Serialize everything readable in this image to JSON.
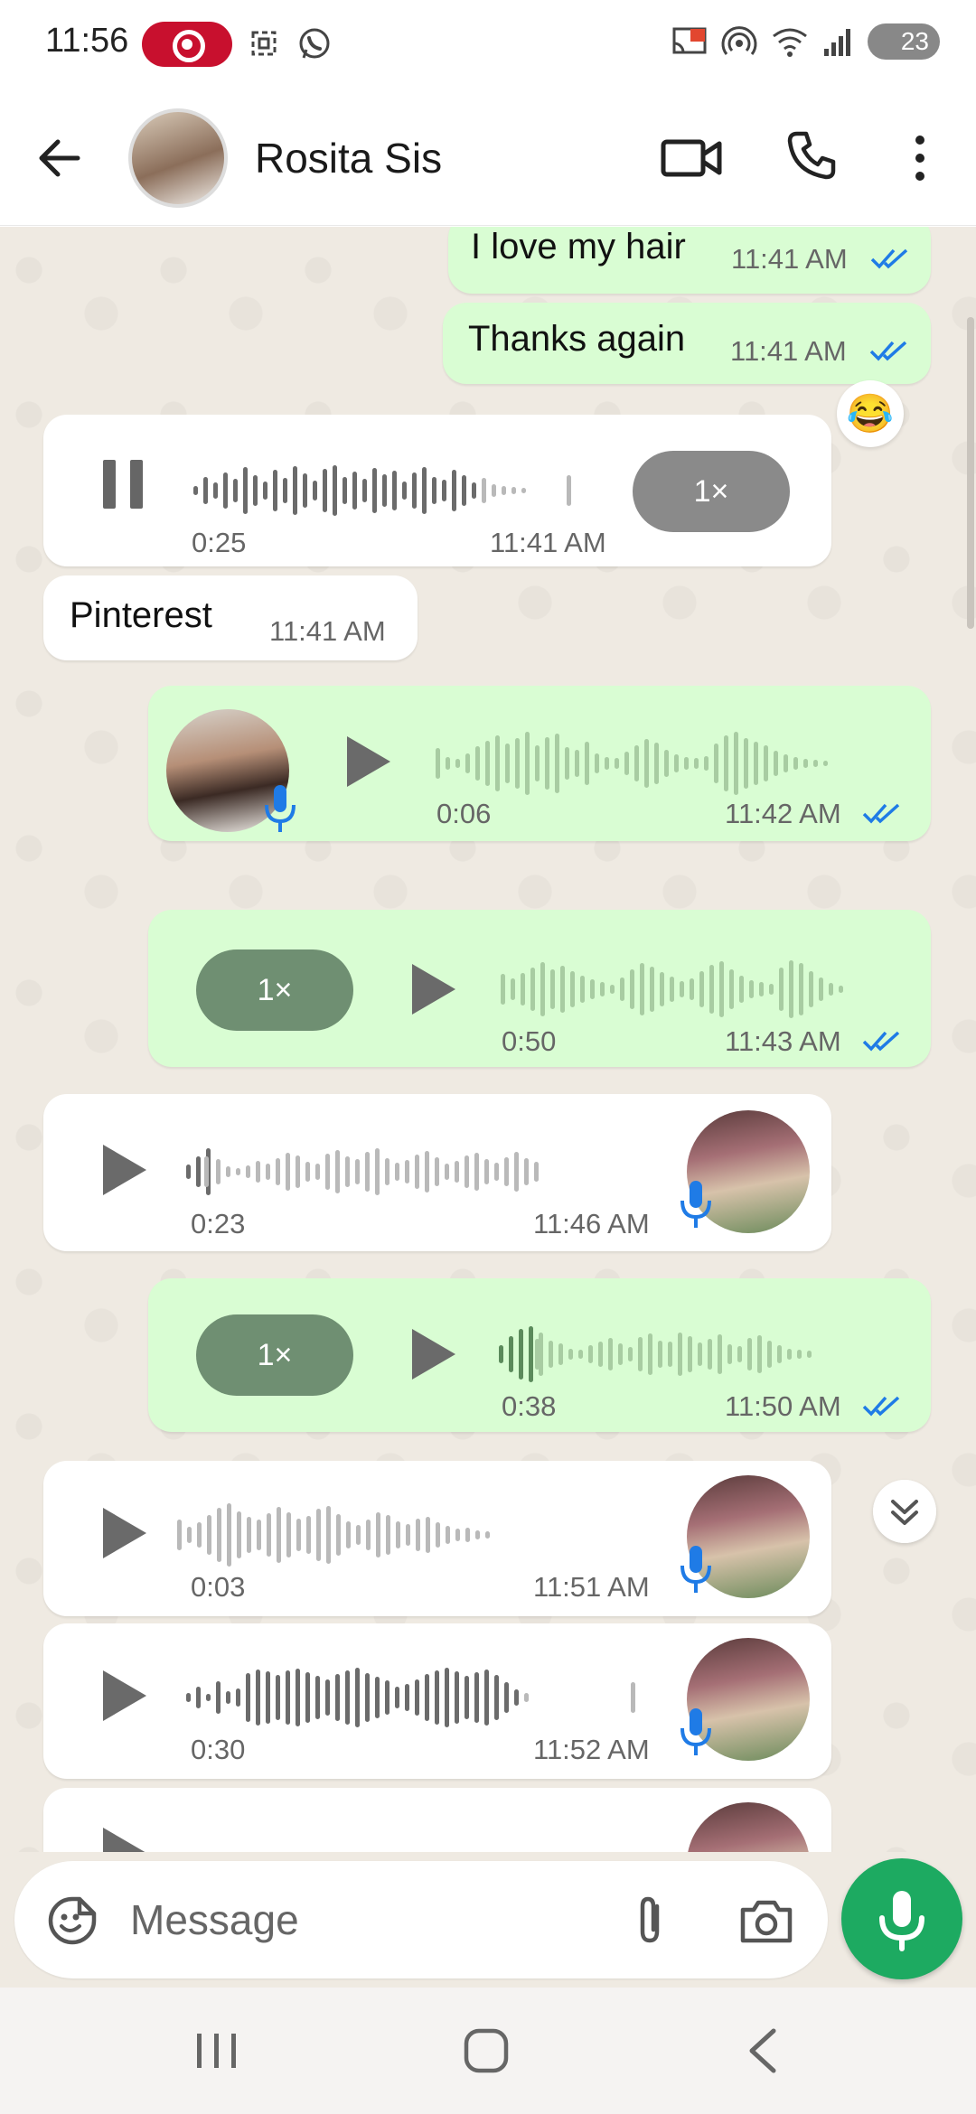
{
  "status_bar": {
    "time": "11:56",
    "battery": "23",
    "icons": [
      "screen-record-icon",
      "screenshot-icon",
      "whatsapp-icon",
      "cast-icon",
      "hotspot-icon",
      "wifi-icon",
      "signal-icon",
      "battery-icon"
    ]
  },
  "header": {
    "contact_name": "Rosita Sis",
    "icons": [
      "back-arrow-icon",
      "video-call-icon",
      "phone-call-icon",
      "more-options-icon"
    ]
  },
  "messages": [
    {
      "type": "text",
      "direction": "out",
      "text": "I love my hair",
      "time": "11:41 AM",
      "status": "read"
    },
    {
      "type": "text",
      "direction": "out",
      "text": "Thanks again",
      "time": "11:41 AM",
      "status": "read"
    },
    {
      "type": "voice",
      "direction": "in",
      "state": "playing",
      "speed": "1×",
      "duration": "0:25",
      "time": "11:41 AM",
      "progress": 0.85
    },
    {
      "type": "text",
      "direction": "in",
      "text": "Pinterest",
      "time": "11:41 AM"
    },
    {
      "type": "voice",
      "direction": "out",
      "state": "paused",
      "duration": "0:06",
      "time": "11:42 AM",
      "status": "read",
      "progress": 0.0,
      "reaction": "😂"
    },
    {
      "type": "voice",
      "direction": "out",
      "state": "paused",
      "speed": "1×",
      "duration": "0:50",
      "time": "11:43 AM",
      "status": "read",
      "progress": 0.02
    },
    {
      "type": "voice",
      "direction": "in",
      "state": "paused",
      "duration": "0:23",
      "time": "11:46 AM",
      "progress": 0.07
    },
    {
      "type": "voice",
      "direction": "out",
      "state": "paused",
      "speed": "1×",
      "duration": "0:38",
      "time": "11:50 AM",
      "status": "read",
      "progress": 0.13
    },
    {
      "type": "voice",
      "direction": "in",
      "state": "paused",
      "duration": "0:03",
      "time": "11:51 AM",
      "progress": 0.0
    },
    {
      "type": "voice",
      "direction": "in",
      "state": "paused",
      "duration": "0:30",
      "time": "11:52 AM",
      "progress": 0.98
    }
  ],
  "input": {
    "placeholder": "Message",
    "icons": [
      "emoji-sticker-icon",
      "attach-icon",
      "camera-icon",
      "microphone-icon"
    ]
  },
  "colors": {
    "outgoing_bubble": "#d9fdd3",
    "incoming_bubble": "#ffffff",
    "chat_background": "#efeae2",
    "accent_green": "#1daa61",
    "read_tick_blue": "#1f7be6"
  }
}
